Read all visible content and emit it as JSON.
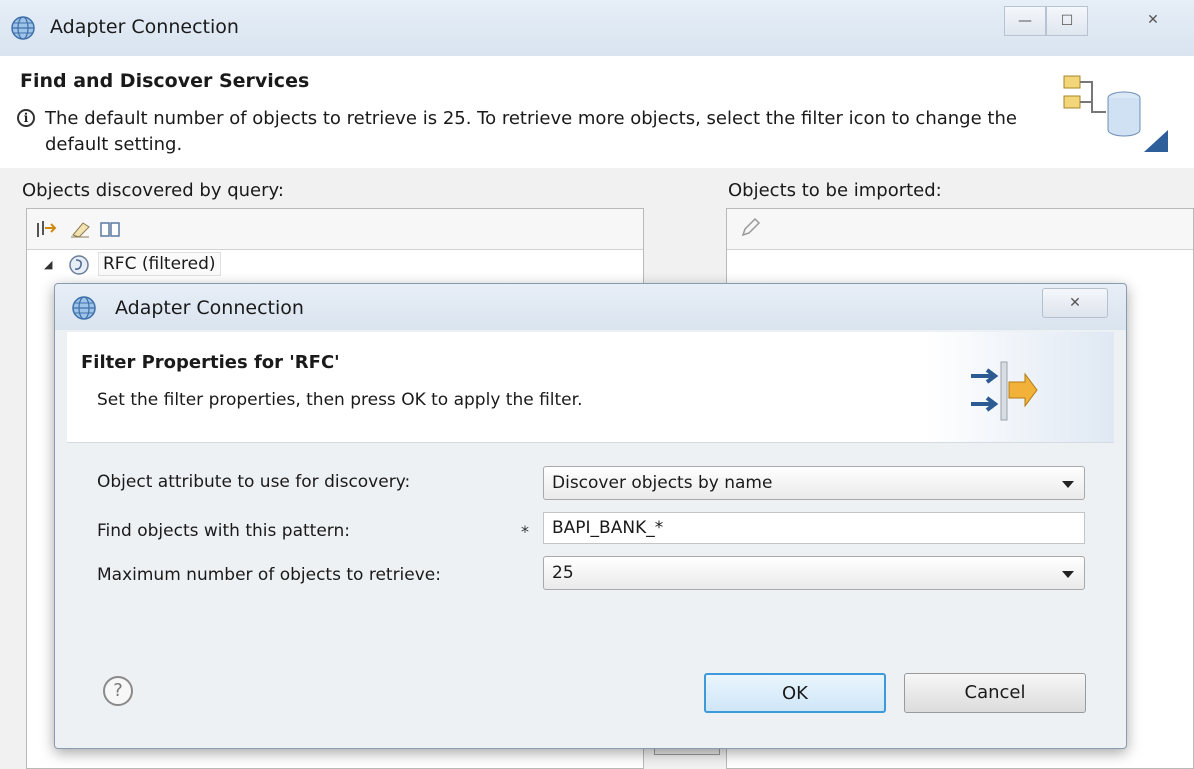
{
  "main_window": {
    "title": "Adapter Connection",
    "heading": "Find and Discover Services",
    "info_text": "The default number of objects to retrieve is 25. To retrieve more objects, select the filter icon to change the default setting.",
    "left_label": "Objects discovered by query:",
    "right_label": "Objects to be imported:",
    "tree": {
      "node_label": "RFC (filtered)"
    },
    "controls": {
      "minimize": "—",
      "maximize": "☐",
      "close": "✕"
    }
  },
  "dialog": {
    "title": "Adapter Connection",
    "close_glyph": "✕",
    "heading": "Filter Properties for 'RFC'",
    "subtitle": "Set the filter properties, then press OK to apply the filter.",
    "fields": {
      "attribute_label": "Object attribute to use for discovery:",
      "attribute_value": "Discover objects by name",
      "pattern_label": "Find objects with this pattern:",
      "pattern_required": "*",
      "pattern_value": "BAPI_BANK_*",
      "max_label": "Maximum number of objects to retrieve:",
      "max_value": "25"
    },
    "help_glyph": "?",
    "ok_label": "OK",
    "cancel_label": "Cancel"
  }
}
